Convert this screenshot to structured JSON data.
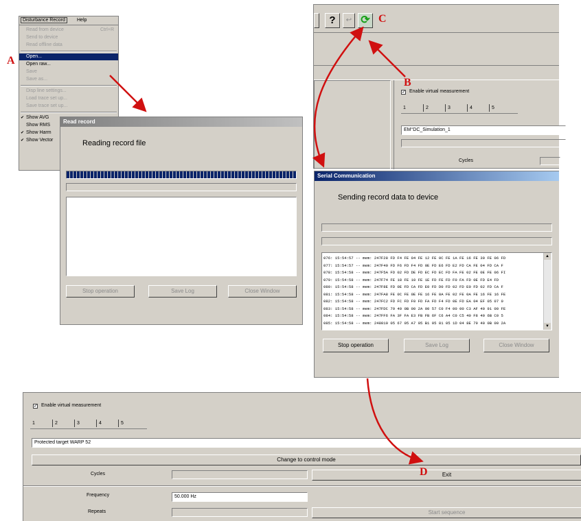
{
  "menu": {
    "bar_title": "Disturbance Record",
    "bar_help": "Help",
    "items": [
      {
        "label": "Read from device",
        "shortcut": "Ctrl+R",
        "disabled": true
      },
      {
        "label": "Send to device",
        "disabled": true
      },
      {
        "label": "Read offline data",
        "disabled": true
      },
      {
        "label": "Open...",
        "disabled": false,
        "selected": true
      },
      {
        "label": "Open raw...",
        "disabled": false
      },
      {
        "label": "Save",
        "disabled": true
      },
      {
        "label": "Save as...",
        "disabled": true
      },
      {
        "label": "Disp line settings...",
        "disabled": true
      },
      {
        "label": "Load trace set up...",
        "disabled": true
      },
      {
        "label": "Save trace set up...",
        "disabled": true
      },
      {
        "label": "Show AVG",
        "checked": true
      },
      {
        "label": "Show RMS",
        "checked": false
      },
      {
        "label": "Show Harm",
        "checked": true
      },
      {
        "label": "Show Vector",
        "checked": true
      }
    ]
  },
  "read_dialog": {
    "title": "Read record",
    "message": "Reading record file",
    "progress": 1.0,
    "buttons": {
      "stop": "Stop operation",
      "save_log": "Save Log",
      "close": "Close Window"
    }
  },
  "toolbar": {
    "help_glyph": "?",
    "refresh_glyph": "⟳"
  },
  "virtual_top": {
    "enable_label": "Enable virtual measurement",
    "tabs": [
      "1",
      "2",
      "3",
      "4",
      "5"
    ],
    "name_value": "EM°DC_Simulation_1",
    "cycles_label": "Cycles"
  },
  "send_dialog": {
    "title": "Serial Communication",
    "message": "Sending record data to device",
    "log_lines": [
      "076: 15:54:57 -- mem: 247F28 FD F4 FE 04 FE 12 FE 0C FE 1A FE 16 FE 30 FE 06 FD",
      "077: 15:54:57 -- mem: 247F40 FD F6 FD F4 FD 0E FD E6 FD E2 FD CA FE 04 FD CA F",
      "078: 15:54:58 -- mem: 247F5A FD 02 FD DE FD EC FD EC FD FA FE 02 FE 0E FE 06 FI",
      "079: 15:54:58 -- mem: 247F74 FE 18 FE 10 FE 1E FD FE FD F0 FA FD 0E FD E4 FD",
      "080: 15:54:58 -- mem: 247F8E FD 0E FD CA FD E0 FD D0 FD 02 FD E0 FD 02 FD CA F",
      "081: 15:54:58 -- mem: 247FA8 FE 0C FE 0E FE 16 FE 0A FE 02 FE 0A FE 16 FE 16 FE",
      "082: 15:54:58 -- mem: 247FC2 FD FC FD F0 FD FA FD F4 FD 0E FD EA 04 EF 05 07 0",
      "083: 15:54:58 -- mem: 247FDC 79 40 0B 00 2A 00 57 C0 F4 00 00 C3 AF 40 91 00 FE",
      "084: 15:54:58 -- mem: 247FF6 FA 3F FA E3 FB FB 6F C6 A4 C0 C5 40 F8 40 6B C0 5",
      "085: 15:54:58 -- mem: 248010 05 67 05 A7 05 B1 05 81 05 1D 04 8E 79 40 0B 00 2A"
    ],
    "buttons": {
      "stop": "Stop operation",
      "save_log": "Save Log",
      "close": "Close Window"
    }
  },
  "virtual_bottom": {
    "enable_label": "Enable virtual measurement",
    "tabs": [
      "1",
      "2",
      "3",
      "4",
      "5"
    ],
    "name_value": "Protected target WARP 52",
    "change_button": "Change to control mode",
    "cycles_label": "Cycles",
    "exit_button": "Exit",
    "frequency_label": "Frequency",
    "frequency_value": "50.000 Hz",
    "repeats_label": "Repeats",
    "start_button": "Start sequence"
  },
  "annotations": {
    "a": "A",
    "b": "B",
    "c": "C",
    "d": "D"
  },
  "colors": {
    "annotation": "#d01010",
    "title_active": "#0a246a",
    "progress": "#0a246a",
    "window": "#d4d0c8"
  }
}
